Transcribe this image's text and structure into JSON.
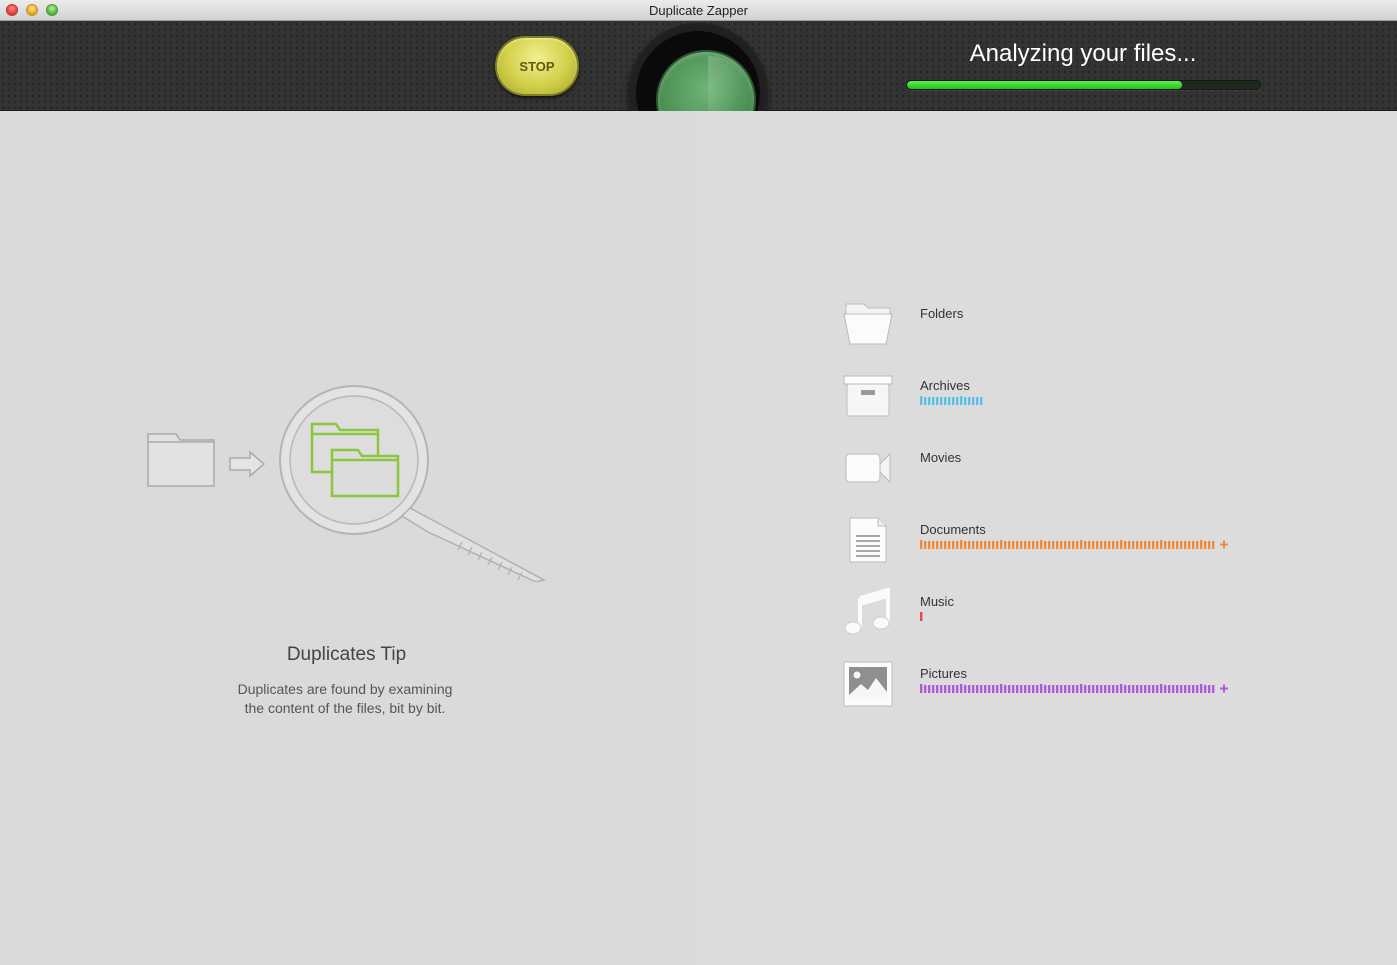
{
  "window": {
    "title": "Duplicate Zapper"
  },
  "toolbar": {
    "stop_label": "STOP",
    "status_text": "Analyzing your files...",
    "progress": 0.78
  },
  "tip": {
    "title": "Duplicates Tip",
    "text_line1": "Duplicates are found by examining",
    "text_line2": "the content of the files, bit by bit."
  },
  "categories": [
    {
      "label": "Folders",
      "icon": "folder-icon",
      "color": "",
      "ticks": 0,
      "more": false
    },
    {
      "label": "Archives",
      "icon": "archive-box-icon",
      "color": "#5bc0e8",
      "ticks": 16,
      "more": false
    },
    {
      "label": "Movies",
      "icon": "video-camera-icon",
      "color": "",
      "ticks": 0,
      "more": false
    },
    {
      "label": "Documents",
      "icon": "document-icon",
      "color": "#f2893a",
      "ticks": 74,
      "more": true
    },
    {
      "label": "Music",
      "icon": "music-note-icon",
      "color": "#e24c3c",
      "ticks": 1,
      "more": false
    },
    {
      "label": "Pictures",
      "icon": "picture-icon",
      "color": "#b25ad9",
      "ticks": 74,
      "more": true
    }
  ]
}
